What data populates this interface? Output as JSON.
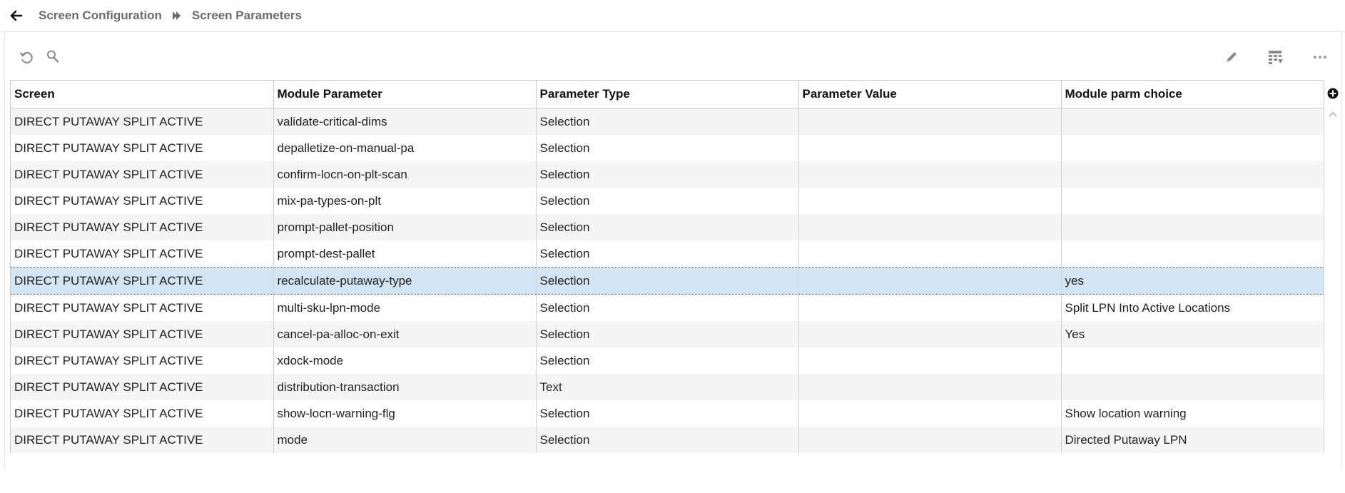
{
  "breadcrumb": {
    "parent": "Screen Configuration",
    "current": "Screen Parameters"
  },
  "icons": {
    "back": "arrow-left-icon",
    "separator": "double-chevron-right-icon",
    "refresh": "refresh-icon",
    "search": "search-icon",
    "edit": "pencil-icon",
    "columns": "column-chooser-icon",
    "more": "more-horizontal-icon",
    "add_column": "plus-circle-icon",
    "scroll_up": "chevron-up-icon"
  },
  "colors": {
    "selected_row": "#d3e4f3",
    "alt_row": "#f5f5f5",
    "icon": "#8a8a8a"
  },
  "grid": {
    "columns": [
      "Screen",
      "Module Parameter",
      "Parameter Type",
      "Parameter Value",
      "Module parm choice"
    ],
    "rows": [
      {
        "screen": "DIRECT PUTAWAY SPLIT ACTIVE",
        "param": "validate-critical-dims",
        "type": "Selection",
        "value": "",
        "choice": ""
      },
      {
        "screen": "DIRECT PUTAWAY SPLIT ACTIVE",
        "param": "depalletize-on-manual-pa",
        "type": "Selection",
        "value": "",
        "choice": ""
      },
      {
        "screen": "DIRECT PUTAWAY SPLIT ACTIVE",
        "param": "confirm-locn-on-plt-scan",
        "type": "Selection",
        "value": "",
        "choice": ""
      },
      {
        "screen": "DIRECT PUTAWAY SPLIT ACTIVE",
        "param": "mix-pa-types-on-plt",
        "type": "Selection",
        "value": "",
        "choice": ""
      },
      {
        "screen": "DIRECT PUTAWAY SPLIT ACTIVE",
        "param": "prompt-pallet-position",
        "type": "Selection",
        "value": "",
        "choice": ""
      },
      {
        "screen": "DIRECT PUTAWAY SPLIT ACTIVE",
        "param": "prompt-dest-pallet",
        "type": "Selection",
        "value": "",
        "choice": ""
      },
      {
        "screen": "DIRECT PUTAWAY SPLIT ACTIVE",
        "param": "recalculate-putaway-type",
        "type": "Selection",
        "value": "",
        "choice": "yes",
        "selected": true
      },
      {
        "screen": "DIRECT PUTAWAY SPLIT ACTIVE",
        "param": "multi-sku-lpn-mode",
        "type": "Selection",
        "value": "",
        "choice": "Split LPN Into Active Locations"
      },
      {
        "screen": "DIRECT PUTAWAY SPLIT ACTIVE",
        "param": "cancel-pa-alloc-on-exit",
        "type": "Selection",
        "value": "",
        "choice": "Yes"
      },
      {
        "screen": "DIRECT PUTAWAY SPLIT ACTIVE",
        "param": "xdock-mode",
        "type": "Selection",
        "value": "",
        "choice": ""
      },
      {
        "screen": "DIRECT PUTAWAY SPLIT ACTIVE",
        "param": "distribution-transaction",
        "type": "Text",
        "value": "",
        "choice": ""
      },
      {
        "screen": "DIRECT PUTAWAY SPLIT ACTIVE",
        "param": "show-locn-warning-flg",
        "type": "Selection",
        "value": "",
        "choice": "Show location warning"
      },
      {
        "screen": "DIRECT PUTAWAY SPLIT ACTIVE",
        "param": "mode",
        "type": "Selection",
        "value": "",
        "choice": "Directed Putaway LPN"
      }
    ]
  }
}
